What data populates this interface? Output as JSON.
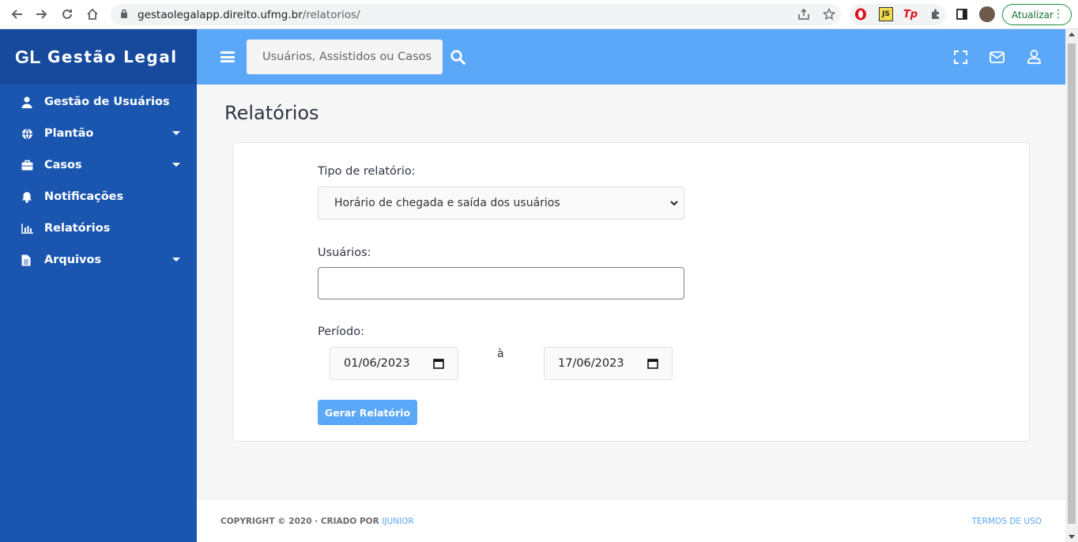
{
  "browser": {
    "url_host": "gestaolegalapp.direito.ufmg.br",
    "url_path": "/relatorios/",
    "update_label": "Atualizar"
  },
  "sidebar": {
    "brand_abbr": "GL",
    "brand_name": "Gestão Legal",
    "items": [
      {
        "label": "Gestão de Usuários",
        "icon": "user-icon",
        "has_caret": false
      },
      {
        "label": "Plantão",
        "icon": "globe-icon",
        "has_caret": true
      },
      {
        "label": "Casos",
        "icon": "briefcase-icon",
        "has_caret": true
      },
      {
        "label": "Notificações",
        "icon": "bell-icon",
        "has_caret": false
      },
      {
        "label": "Relatórios",
        "icon": "chart-icon",
        "has_caret": false
      },
      {
        "label": "Arquivos",
        "icon": "file-icon",
        "has_caret": true
      }
    ]
  },
  "topbar": {
    "search_placeholder": "Usuários, Assistidos ou Casos"
  },
  "main": {
    "title": "Relatórios",
    "report_type_label": "Tipo de relatório:",
    "report_type_value": "Horário de chegada e saída dos usuários",
    "users_label": "Usuários:",
    "users_value": "",
    "period_label": "Período:",
    "date_start": "01/06/2023",
    "between": "à",
    "date_end": "17/06/2023",
    "generate_label": "Gerar Relatório"
  },
  "footer": {
    "copyright": "COPYRIGHT © 2020  ·  CRIADO POR ",
    "creator": "IJUNIOR",
    "terms": "TERMOS DE USO"
  },
  "colors": {
    "sidebar": "#1a56b0",
    "topbar": "#5aa8f7",
    "accent": "#5aa8f7"
  }
}
